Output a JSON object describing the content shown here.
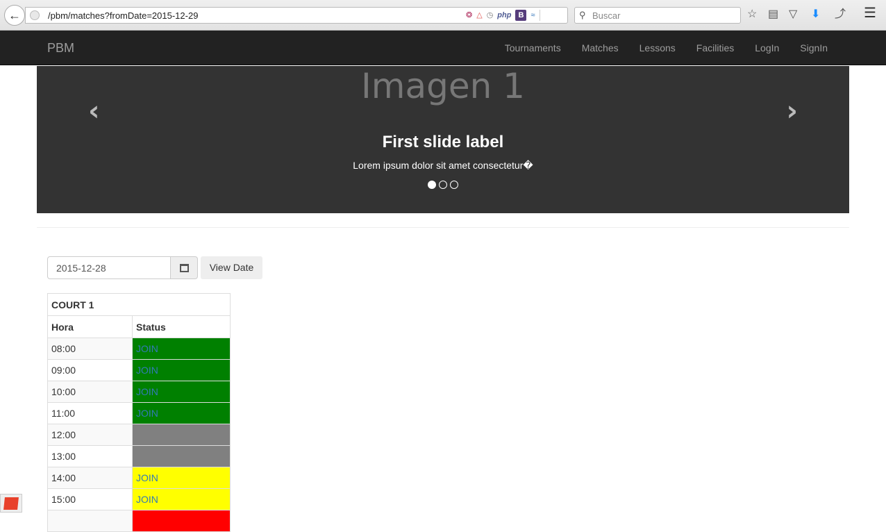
{
  "browser": {
    "url": "/pbm/matches?fromDate=2015-12-29",
    "search_placeholder": "Buscar",
    "addon_bootstrap": "B",
    "addon_php": "php"
  },
  "navbar": {
    "brand": "PBM",
    "links": [
      "Tournaments",
      "Matches",
      "Lessons",
      "Facilities",
      "LogIn",
      "SignIn"
    ]
  },
  "carousel": {
    "image_label": "Imagen 1",
    "caption_title": "First slide label",
    "caption_text": "Lorem ipsum dolor sit amet consectetur�",
    "slide_count": 3,
    "active_index": 0
  },
  "date_form": {
    "value": "2015-12-28",
    "button_label": "View Date"
  },
  "court": {
    "title": "COURT 1",
    "headers": [
      "Hora",
      "Status"
    ],
    "rows": [
      {
        "hora": "08:00",
        "status": "JOIN",
        "color": "#008000"
      },
      {
        "hora": "09:00",
        "status": "JOIN",
        "color": "#008000"
      },
      {
        "hora": "10:00",
        "status": "JOIN",
        "color": "#008000"
      },
      {
        "hora": "11:00",
        "status": "JOIN",
        "color": "#008000"
      },
      {
        "hora": "12:00",
        "status": "",
        "color": "#808080"
      },
      {
        "hora": "13:00",
        "status": "",
        "color": "#808080"
      },
      {
        "hora": "14:00",
        "status": "JOIN",
        "color": "#ffff00"
      },
      {
        "hora": "15:00",
        "status": "JOIN",
        "color": "#ffff00"
      }
    ],
    "next_row_color": "#ff0000"
  }
}
